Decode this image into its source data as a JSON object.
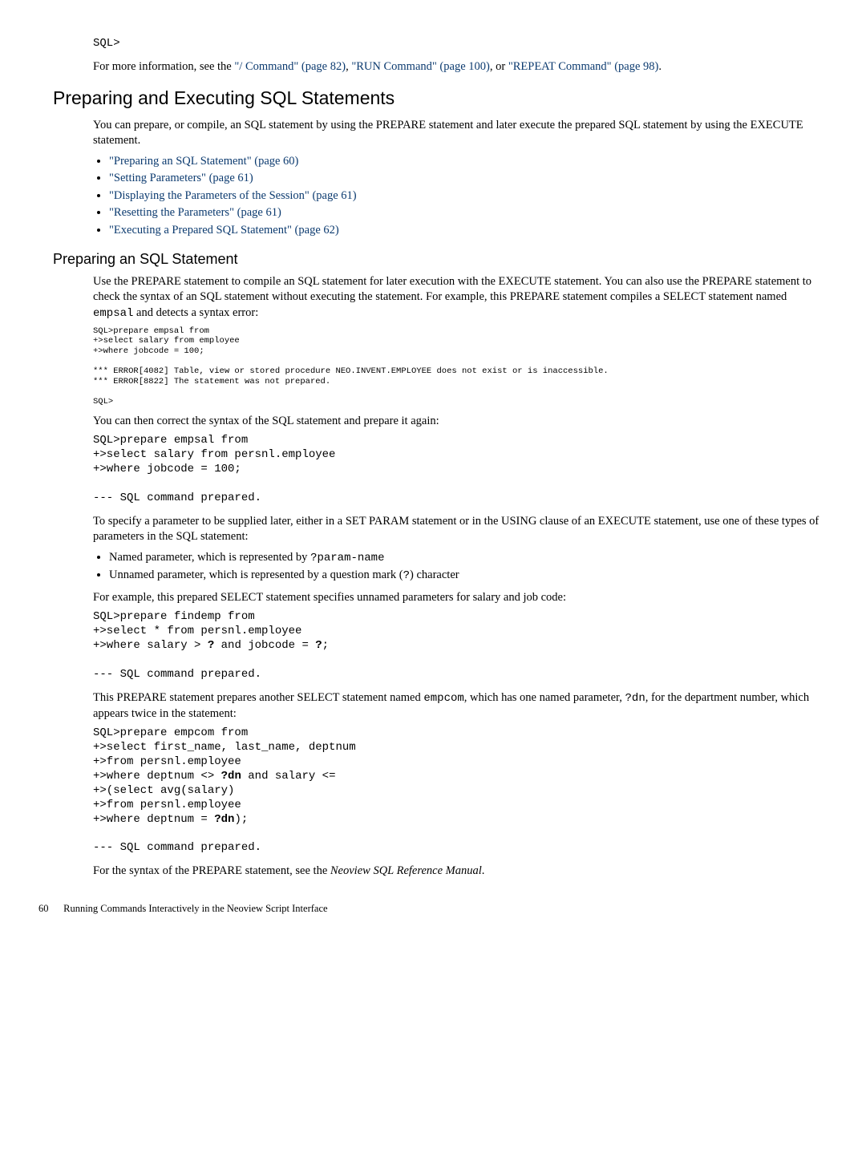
{
  "top_code": "SQL>",
  "top_para_pre": "For more information, see the ",
  "top_link1": "\"/ Command\" (page 82)",
  "top_sep1": ", ",
  "top_link2": "\"RUN Command\" (page 100)",
  "top_sep2": ", or ",
  "top_link3": "\"REPEAT Command\" (page 98)",
  "top_para_post": ".",
  "h2": "Preparing and Executing SQL Statements",
  "p1": "You can prepare, or compile, an SQL statement by using the PREPARE statement and later execute the prepared SQL statement by using the EXECUTE statement.",
  "bullets1": {
    "b1": "\"Preparing an SQL Statement\" (page 60)",
    "b2": "\"Setting Parameters\" (page 61)",
    "b3": "\"Displaying the Parameters of the Session\" (page 61)",
    "b4": "\"Resetting the Parameters\" (page 61)",
    "b5": "\"Executing a Prepared SQL Statement\" (page 62)"
  },
  "h3": "Preparing an SQL Statement",
  "p2_pre": "Use the PREPARE statement to compile an SQL statement for later execution with the EXECUTE statement. You can also use the PREPARE statement to check the syntax of an SQL statement without executing the statement. For example, this PREPARE statement compiles a SELECT statement named ",
  "p2_code": "empsal",
  "p2_post": " and detects a syntax error:",
  "codeA": "SQL>prepare empsal from\n+>select salary from employee\n+>where jobcode = 100;\n\n*** ERROR[4082] Table, view or stored procedure NEO.INVENT.EMPLOYEE does not exist or is inaccessible.\n*** ERROR[8822] The statement was not prepared.\n\nSQL>",
  "p3": "You can then correct the syntax of the SQL statement and prepare it again:",
  "codeB": "SQL>prepare empsal from\n+>select salary from persnl.employee\n+>where jobcode = 100;\n\n--- SQL command prepared.",
  "p4": "To specify a parameter to be supplied later, either in a SET PARAM statement or in the USING clause of an EXECUTE statement, use one of these types of parameters in the SQL statement:",
  "bullets2": {
    "b1_pre": "Named parameter, which is represented by ",
    "b1_code": "?param-name",
    "b2_pre": "Unnamed parameter, which is represented by a question mark (",
    "b2_code": "?",
    "b2_post": ") character"
  },
  "p5": "For example, this prepared SELECT statement specifies unnamed parameters for salary and job code:",
  "codeC_l1": "SQL>prepare findemp from",
  "codeC_l2": "+>select * from persnl.employee",
  "codeC_l3a": "+>where salary > ",
  "codeC_l3b": "?",
  "codeC_l3c": " and jobcode = ",
  "codeC_l3d": "?",
  "codeC_l3e": ";",
  "codeC_l4": "--- SQL command prepared.",
  "p6_pre": "This PREPARE statement prepares another SELECT statement named ",
  "p6_code1": "empcom",
  "p6_mid": ", which has one named parameter, ",
  "p6_code2": "?dn",
  "p6_post": ", for the department number, which appears twice in the statement:",
  "codeD_l1": "SQL>prepare empcom from",
  "codeD_l2": "+>select first_name, last_name, deptnum",
  "codeD_l3": "+>from persnl.employee",
  "codeD_l4a": "+>where deptnum <> ",
  "codeD_l4b": "?dn",
  "codeD_l4c": " and salary <=",
  "codeD_l5": "+>(select avg(salary)",
  "codeD_l6": "+>from persnl.employee",
  "codeD_l7a": "+>where deptnum = ",
  "codeD_l7b": "?dn",
  "codeD_l7c": ");",
  "codeD_l8": "--- SQL command prepared.",
  "p7_pre": "For the syntax of the PREPARE statement, see the ",
  "p7_italic": "Neoview SQL Reference Manual",
  "p7_post": ".",
  "footer_page": "60",
  "footer_text": "Running Commands Interactively in the Neoview Script Interface"
}
